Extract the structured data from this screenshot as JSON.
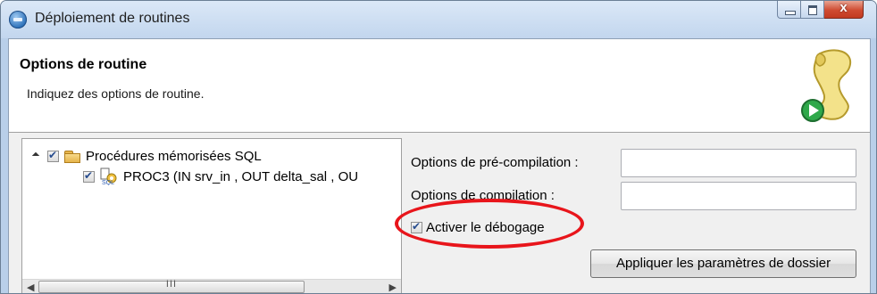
{
  "window": {
    "title": "Déploiement de routines",
    "buttons": {
      "minimize": "minimize",
      "maximize": "maximize",
      "close": "x"
    }
  },
  "banner": {
    "title": "Options de routine",
    "description": "Indiquez des options de routine.",
    "icon": "scroll-run-icon"
  },
  "tree": {
    "root": {
      "label": "Procédures mémorisées SQL",
      "checked": true,
      "expanded": true
    },
    "children": [
      {
        "label": "PROC3 (IN srv_in , OUT delta_sal , OU",
        "checked": true
      }
    ],
    "scrollbar": {
      "thumb_grip": "III"
    }
  },
  "options": {
    "precompile_label": "Options de pré-compilation :",
    "precompile_value": "",
    "compile_label": "Options de compilation :",
    "compile_value": "",
    "debug_label": "Activer le débogage",
    "debug_checked": true,
    "apply_button": "Appliquer les paramètres de dossier"
  },
  "colors": {
    "highlight": "#e8151b",
    "titlebar": "#c2d6ee"
  }
}
